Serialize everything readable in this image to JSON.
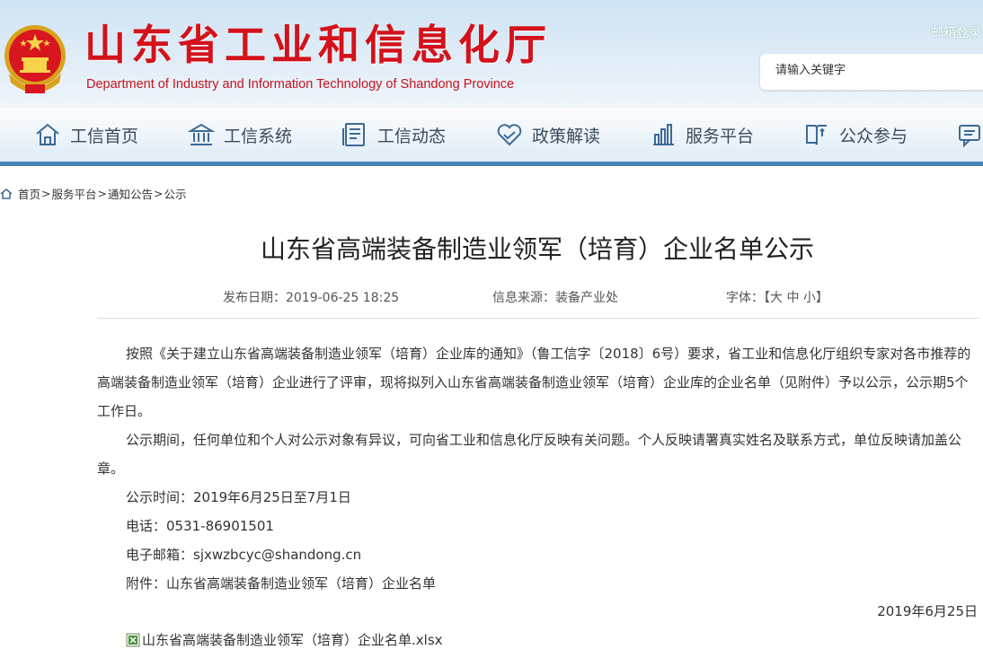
{
  "header": {
    "title": "山东省工业和信息化厅",
    "subtitle": "Department of Industry and Information Technology of Shandong Province",
    "mail_login": "邮箱登录",
    "search_placeholder": "请输入关键字"
  },
  "nav": {
    "items": [
      {
        "label": "工信首页",
        "icon": "home-icon"
      },
      {
        "label": "工信系统",
        "icon": "building-icon"
      },
      {
        "label": "工信动态",
        "icon": "document-icon"
      },
      {
        "label": "政策解读",
        "icon": "handshake-icon"
      },
      {
        "label": "服务平台",
        "icon": "chart-icon"
      },
      {
        "label": "公众参与",
        "icon": "book-icon"
      }
    ]
  },
  "breadcrumb": [
    "首页",
    "服务平台",
    "通知公告",
    "公示"
  ],
  "article": {
    "title": "山东省高端装备制造业领军（培育）企业名单公示",
    "publish_date": "发布日期：2019-06-25 18:25",
    "source": "信息来源：装备产业处",
    "font_label": "字体：",
    "font_sizes": [
      "大",
      "中",
      "小"
    ],
    "paragraph1": "按照《关于建立山东省高端装备制造业领军（培育）企业库的通知》（鲁工信字〔2018〕6号）要求，省工业和信息化厅组织专家对各市推荐的高端装备制造业领军（培育）企业进行了评审，现将拟列入山东省高端装备制造业领军（培育）企业库的企业名单（见附件）予以公示，公示期5个工作日。",
    "paragraph2": "公示期间，任何单位和个人对公示对象有异议，可向省工业和信息化厅反映有关问题。个人反映请署真实姓名及联系方式，单位反映请加盖公章。",
    "notice_time": "公示时间：2019年6月25日至7月1日",
    "phone": "电话：0531-86901501",
    "email": "电子邮箱：sjxwzbcyc@shandong.cn",
    "attachment_label": "附件：山东省高端装备制造业领军（培育）企业名单",
    "date": "2019年6月25日",
    "attachment_file": "山东省高端装备制造业领军（培育）企业名单.xlsx"
  },
  "colors": {
    "title_red": "#d3121b",
    "nav_bar": "#4a84b9"
  }
}
